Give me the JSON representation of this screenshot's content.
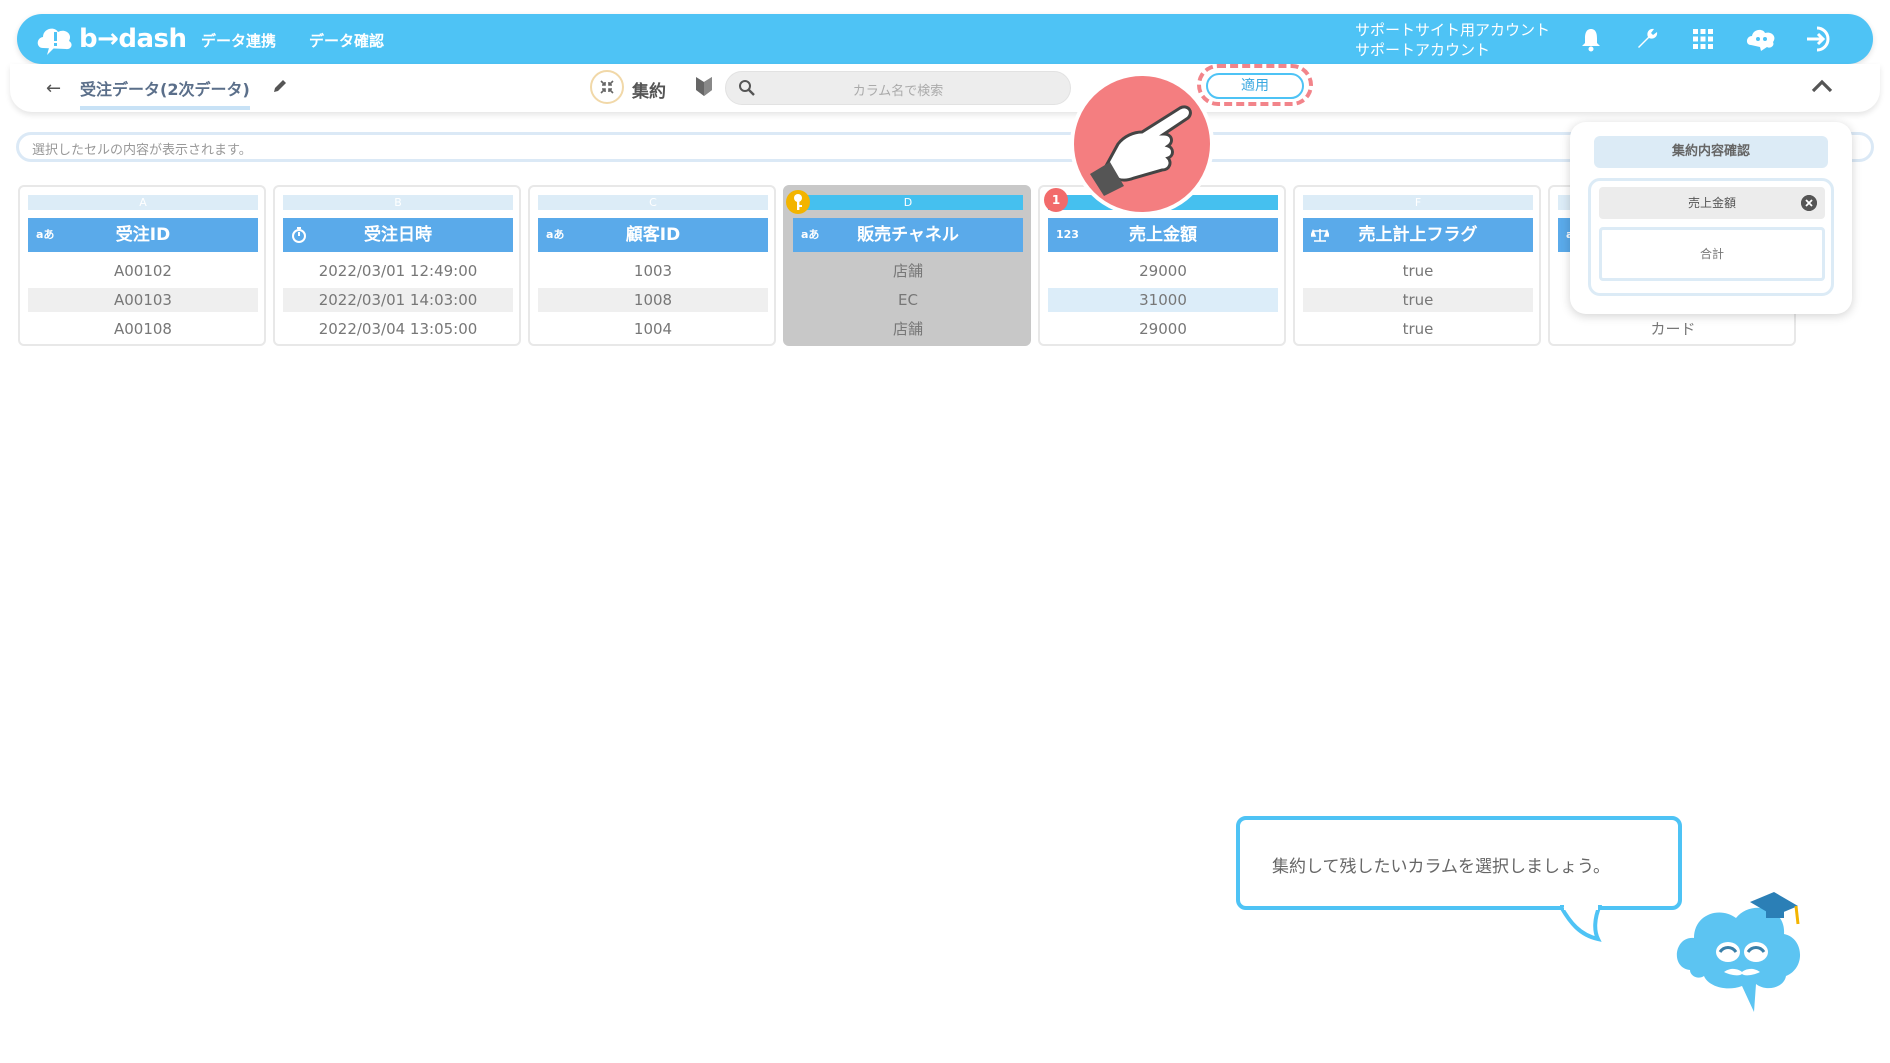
{
  "header": {
    "logo_text": "b→dash",
    "nav": [
      "データ連携",
      "データ確認"
    ],
    "account_line1": "サポートサイト用アカウント",
    "account_line2": "サポートアカウント",
    "icons": [
      "bell-icon",
      "wrench-icon",
      "grid-icon",
      "mascot-icon",
      "logout-icon"
    ]
  },
  "toolbar": {
    "back_icon": "arrow-left-icon",
    "title": "受注データ(2次データ)",
    "mode_label": "集約",
    "search_placeholder": "カラム名で検索",
    "apply_label": "適用"
  },
  "cellbar": {
    "placeholder": "選択したセルの内容が表示されます。"
  },
  "columns": [
    {
      "letter": "A",
      "name": "受注ID",
      "type": "aあ",
      "cells": [
        "A00102",
        "A00103",
        "A00108"
      ]
    },
    {
      "letter": "B",
      "name": "受注日時",
      "type": "clock",
      "cells": [
        "2022/03/01 12:49:00",
        "2022/03/01 14:03:00",
        "2022/03/04 13:05:00"
      ]
    },
    {
      "letter": "C",
      "name": "顧客ID",
      "type": "aあ",
      "cells": [
        "1003",
        "1008",
        "1004"
      ]
    },
    {
      "letter": "D",
      "name": "販売チャネル",
      "type": "aあ",
      "cells": [
        "店舗",
        "EC",
        "店舗"
      ]
    },
    {
      "letter": "",
      "name": "売上金額",
      "type": "123",
      "cells": [
        "29000",
        "31000",
        "29000"
      ]
    },
    {
      "letter": "F",
      "name": "売上計上フラグ",
      "type": "scale",
      "cells": [
        "true",
        "true",
        "true"
      ]
    },
    {
      "letter": "",
      "name": "",
      "type": "aあ",
      "cells": [
        "",
        "",
        "カード"
      ]
    }
  ],
  "badges": {
    "selected_count": "1"
  },
  "panel": {
    "title": "集約内容確認",
    "field": "売上金額",
    "function": "合計"
  },
  "bubble": {
    "text": "集約して残したいカラムを選択しましょう。"
  },
  "colors": {
    "header_bg": "#4ec3f5",
    "column_head": "#5aaaea",
    "highlight_red": "#f2848a",
    "key_badge": "#f3b400"
  }
}
